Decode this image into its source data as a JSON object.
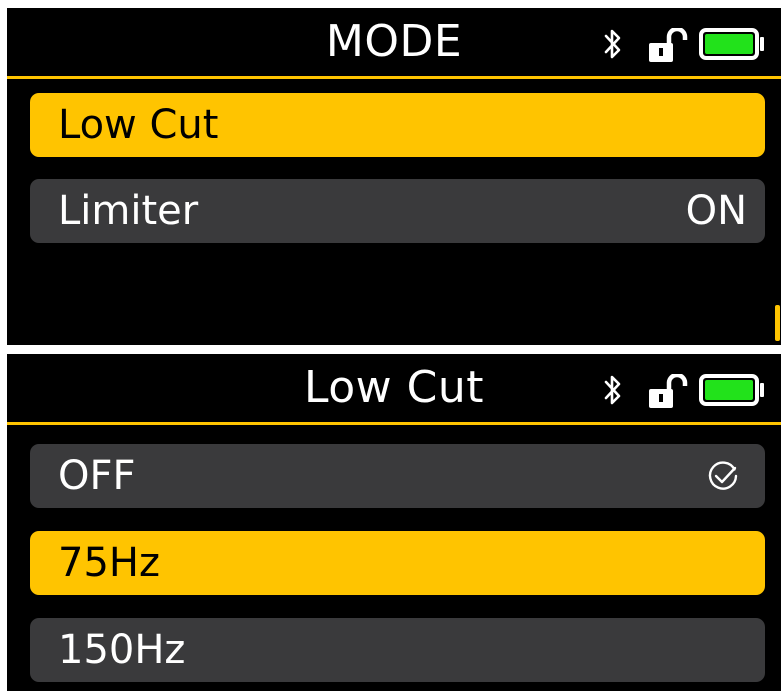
{
  "colors": {
    "accent": "#ffc400",
    "row_bg": "#3a3a3c",
    "screen_bg": "#000000",
    "battery_fill": "#22e21b",
    "text": "#ffffff"
  },
  "screen1": {
    "title": "MODE",
    "status": {
      "icons": [
        "bluetooth-icon",
        "unlock-icon",
        "battery-icon"
      ],
      "battery_level": 1.0
    },
    "items": [
      {
        "label": "Low Cut",
        "value": "",
        "selected": true
      },
      {
        "label": "Limiter",
        "value": "ON",
        "selected": false
      }
    ],
    "scroll_indicator": true
  },
  "screen2": {
    "title": "Low Cut",
    "status": {
      "icons": [
        "bluetooth-icon",
        "unlock-icon",
        "battery-icon"
      ],
      "battery_level": 1.0
    },
    "items": [
      {
        "label": "OFF",
        "checked": true,
        "selected": false
      },
      {
        "label": "75Hz",
        "checked": false,
        "selected": true
      },
      {
        "label": "150Hz",
        "checked": false,
        "selected": false
      }
    ]
  }
}
